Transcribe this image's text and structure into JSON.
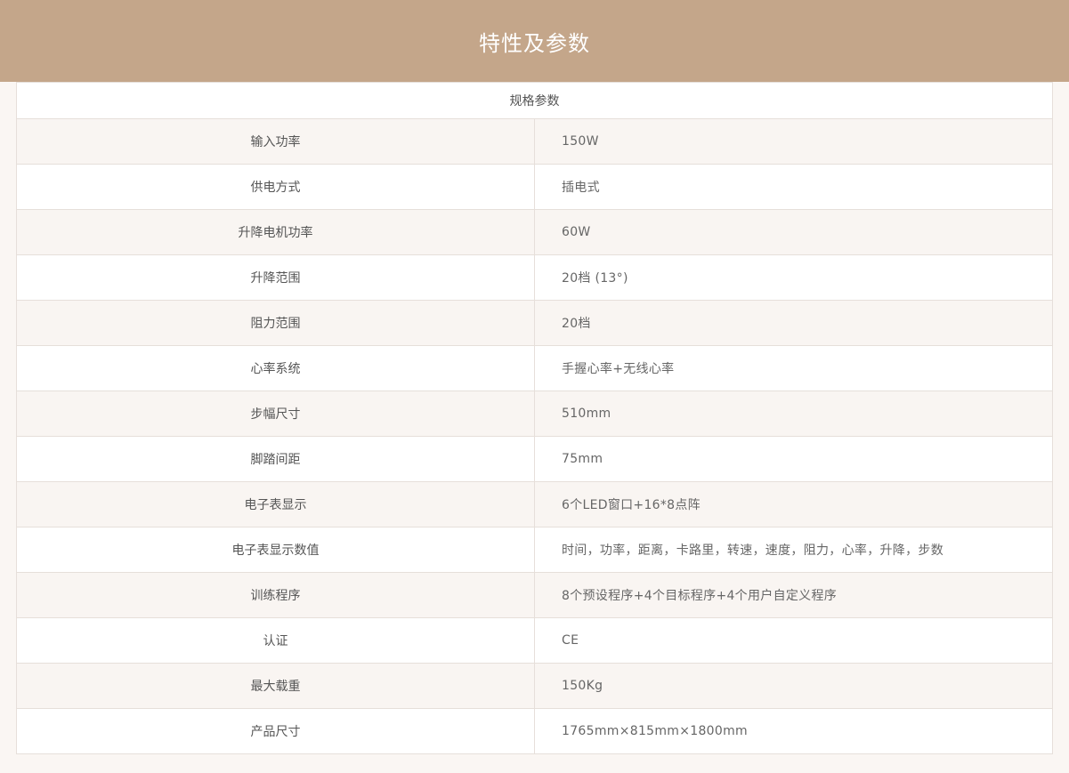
{
  "header": {
    "title": "特性及参数"
  },
  "table": {
    "caption": "规格参数",
    "rows": [
      {
        "label": "输入功率",
        "value": "150W"
      },
      {
        "label": "供电方式",
        "value": "插电式"
      },
      {
        "label": "升降电机功率",
        "value": "60W"
      },
      {
        "label": "升降范围",
        "value": "20档 (13°)"
      },
      {
        "label": "阻力范围",
        "value": "20档"
      },
      {
        "label": "心率系统",
        "value": "手握心率+无线心率"
      },
      {
        "label": "步幅尺寸",
        "value": "510mm"
      },
      {
        "label": "脚踏间距",
        "value": "75mm"
      },
      {
        "label": "电子表显示",
        "value": "6个LED窗口+16*8点阵"
      },
      {
        "label": "电子表显示数值",
        "value": "时间，功率，距离，卡路里，转速，速度，阻力，心率，升降，步数"
      },
      {
        "label": "训练程序",
        "value": "8个预设程序+4个目标程序+4个用户自定义程序"
      },
      {
        "label": "认证",
        "value": "CE"
      },
      {
        "label": "最大载重",
        "value": "150Kg"
      },
      {
        "label": "产品尺寸",
        "value": "1765mm×815mm×1800mm"
      }
    ]
  },
  "colors": {
    "header_bg": "#c4a68a",
    "page_bg": "#faf6f3",
    "row_alt_bg": "#f9f5f2",
    "border": "#e6dfda"
  }
}
